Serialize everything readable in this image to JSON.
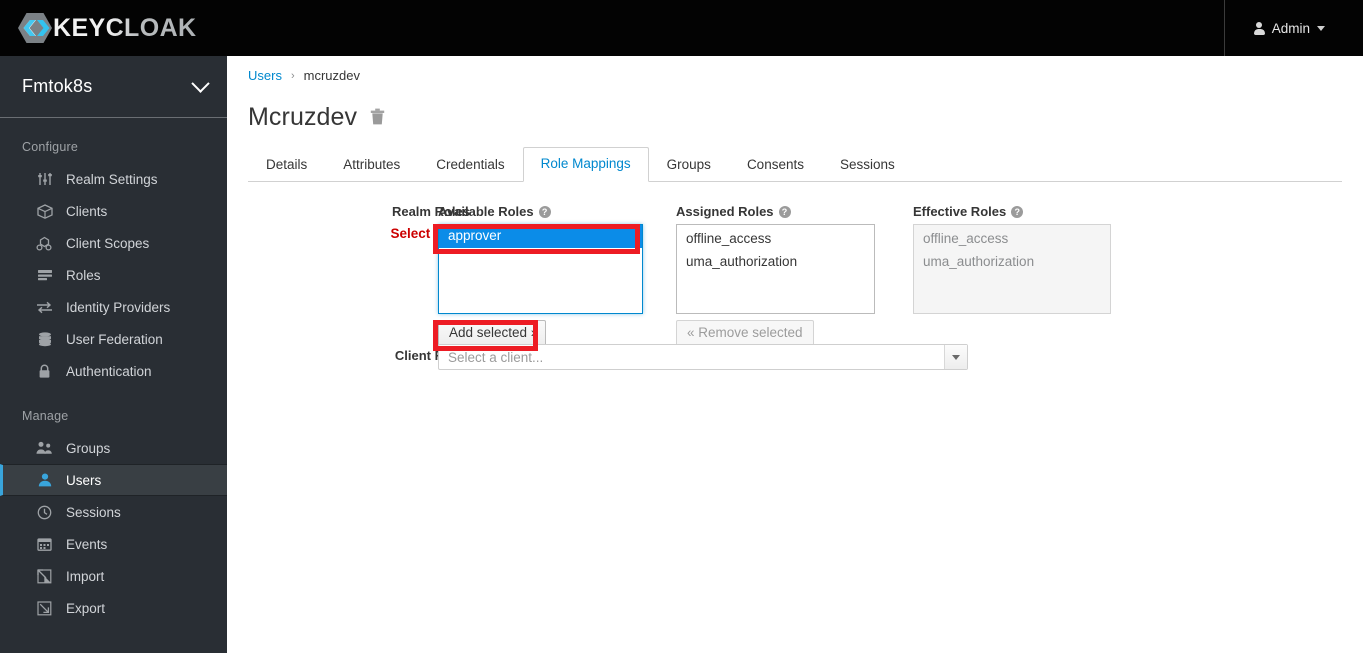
{
  "header": {
    "brand": "KEYCLOAK",
    "logo_icon": "keycloak-hexagon-logo",
    "admin_label": "Admin",
    "admin_icon": "user-icon",
    "admin_caret_icon": "chevron-down-icon"
  },
  "sidebar": {
    "realm": "Fmtok8s",
    "realm_caret_icon": "chevron-down-icon",
    "groups": [
      {
        "title": "Configure",
        "items": [
          {
            "label": "Realm Settings",
            "icon": "sliders-icon",
            "active": false
          },
          {
            "label": "Clients",
            "icon": "cube-icon",
            "active": false
          },
          {
            "label": "Client Scopes",
            "icon": "molecule-icon",
            "active": false
          },
          {
            "label": "Roles",
            "icon": "list-bars-icon",
            "active": false
          },
          {
            "label": "Identity Providers",
            "icon": "exchange-arrows-icon",
            "active": false
          },
          {
            "label": "User Federation",
            "icon": "database-icon",
            "active": false
          },
          {
            "label": "Authentication",
            "icon": "lock-icon",
            "active": false
          }
        ]
      },
      {
        "title": "Manage",
        "items": [
          {
            "label": "Groups",
            "icon": "users-group-icon",
            "active": false
          },
          {
            "label": "Users",
            "icon": "user-icon",
            "active": true
          },
          {
            "label": "Sessions",
            "icon": "clock-icon",
            "active": false
          },
          {
            "label": "Events",
            "icon": "calendar-icon",
            "active": false
          },
          {
            "label": "Import",
            "icon": "import-arrow-icon",
            "active": false
          },
          {
            "label": "Export",
            "icon": "export-arrow-icon",
            "active": false
          }
        ]
      }
    ]
  },
  "breadcrumb": {
    "parent": "Users",
    "separator": "›",
    "current": "mcruzdev"
  },
  "page": {
    "title": "Mcruzdev",
    "delete_icon": "trash-icon"
  },
  "tabs": [
    {
      "label": "Details",
      "active": false
    },
    {
      "label": "Attributes",
      "active": false
    },
    {
      "label": "Credentials",
      "active": false
    },
    {
      "label": "Role Mappings",
      "active": true
    },
    {
      "label": "Groups",
      "active": false
    },
    {
      "label": "Consents",
      "active": false
    },
    {
      "label": "Sessions",
      "active": false
    }
  ],
  "form": {
    "realm_roles_label": "Realm Roles",
    "validation_message": "Select a role",
    "available": {
      "heading": "Available Roles",
      "help_icon": "help-circle-icon",
      "help_glyph": "?",
      "options": [
        {
          "label": "approver",
          "selected": true
        }
      ],
      "button": "Add selected ›",
      "button_disabled": false
    },
    "assigned": {
      "heading": "Assigned Roles",
      "help_icon": "help-circle-icon",
      "help_glyph": "?",
      "options": [
        {
          "label": "offline_access",
          "selected": false
        },
        {
          "label": "uma_authorization",
          "selected": false
        }
      ],
      "button": "« Remove selected",
      "button_disabled": true
    },
    "effective": {
      "heading": "Effective Roles",
      "help_icon": "help-circle-icon",
      "help_glyph": "?",
      "options": [
        {
          "label": "offline_access",
          "selected": false
        },
        {
          "label": "uma_authorization",
          "selected": false
        }
      ]
    },
    "client_roles_label": "Client Roles",
    "client_select_placeholder": "Select a client...",
    "client_select_caret_icon": "caret-down-icon"
  },
  "annotations": {
    "highlight_color": "#ed1c24",
    "boxes": [
      {
        "target": "available-role-approver"
      },
      {
        "target": "add-selected-button"
      }
    ]
  },
  "colors": {
    "header_bg": "#030303",
    "sidebar_bg": "#292e34",
    "active_nav": "#39a5dc",
    "link_blue": "#0088ce",
    "selection_blue": "#0b8ce8",
    "error_red": "#cc0000"
  }
}
